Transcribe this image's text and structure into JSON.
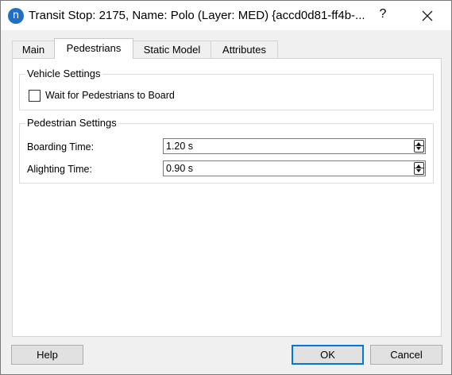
{
  "window": {
    "title": "Transit Stop: 2175, Name: Polo (Layer: MED) {accd0d81-ff4b-...",
    "app_icon_letter": "n",
    "help_label": "?",
    "close_icon": "close-icon"
  },
  "tabs": [
    {
      "label": "Main",
      "active": false
    },
    {
      "label": "Pedestrians",
      "active": true
    },
    {
      "label": "Static Model",
      "active": false
    },
    {
      "label": "Attributes",
      "active": false
    }
  ],
  "vehicle_settings": {
    "title": "Vehicle Settings",
    "wait_checkbox": {
      "label": "Wait for Pedestrians to Board",
      "checked": false
    }
  },
  "pedestrian_settings": {
    "title": "Pedestrian Settings",
    "boarding": {
      "label": "Boarding Time:",
      "value": "1.20 s"
    },
    "alighting": {
      "label": "Alighting Time:",
      "value": "0.90 s"
    }
  },
  "buttons": {
    "help": "Help",
    "ok": "OK",
    "cancel": "Cancel"
  },
  "colors": {
    "accent": "#0078d7",
    "app_icon": "#1f6fc5"
  }
}
